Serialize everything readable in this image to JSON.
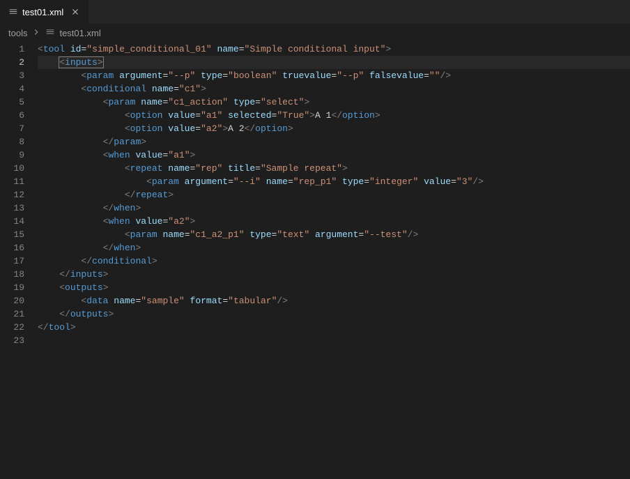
{
  "tab": {
    "filename": "test01.xml"
  },
  "breadcrumb": {
    "folder": "tools",
    "file": "test01.xml"
  },
  "editor": {
    "activeLine": 2,
    "lines": [
      {
        "n": 1,
        "indent": 0,
        "segments": [
          {
            "t": "brkt",
            "v": "<"
          },
          {
            "t": "tag",
            "v": "tool"
          },
          {
            "t": "txt",
            "v": " "
          },
          {
            "t": "attr",
            "v": "id"
          },
          {
            "t": "txt",
            "v": "="
          },
          {
            "t": "str",
            "v": "\"simple_conditional_01\""
          },
          {
            "t": "txt",
            "v": " "
          },
          {
            "t": "attr",
            "v": "name"
          },
          {
            "t": "txt",
            "v": "="
          },
          {
            "t": "str",
            "v": "\"Simple conditional input\""
          },
          {
            "t": "brkt",
            "v": ">"
          }
        ]
      },
      {
        "n": 2,
        "indent": 1,
        "segments": [
          {
            "t": "brkt",
            "v": "<"
          },
          {
            "t": "tag",
            "v": "inputs"
          },
          {
            "t": "brkt",
            "v": ">"
          }
        ],
        "outline": true
      },
      {
        "n": 3,
        "indent": 2,
        "segments": [
          {
            "t": "brkt",
            "v": "<"
          },
          {
            "t": "tag",
            "v": "param"
          },
          {
            "t": "txt",
            "v": " "
          },
          {
            "t": "attr",
            "v": "argument"
          },
          {
            "t": "txt",
            "v": "="
          },
          {
            "t": "str",
            "v": "\"--p\""
          },
          {
            "t": "txt",
            "v": " "
          },
          {
            "t": "attr",
            "v": "type"
          },
          {
            "t": "txt",
            "v": "="
          },
          {
            "t": "str",
            "v": "\"boolean\""
          },
          {
            "t": "txt",
            "v": " "
          },
          {
            "t": "attr",
            "v": "truevalue"
          },
          {
            "t": "txt",
            "v": "="
          },
          {
            "t": "str",
            "v": "\"--p\""
          },
          {
            "t": "txt",
            "v": " "
          },
          {
            "t": "attr",
            "v": "falsevalue"
          },
          {
            "t": "txt",
            "v": "="
          },
          {
            "t": "str",
            "v": "\"\""
          },
          {
            "t": "brkt",
            "v": "/>"
          }
        ]
      },
      {
        "n": 4,
        "indent": 2,
        "segments": [
          {
            "t": "brkt",
            "v": "<"
          },
          {
            "t": "tag",
            "v": "conditional"
          },
          {
            "t": "txt",
            "v": " "
          },
          {
            "t": "attr",
            "v": "name"
          },
          {
            "t": "txt",
            "v": "="
          },
          {
            "t": "str",
            "v": "\"c1\""
          },
          {
            "t": "brkt",
            "v": ">"
          }
        ]
      },
      {
        "n": 5,
        "indent": 3,
        "segments": [
          {
            "t": "brkt",
            "v": "<"
          },
          {
            "t": "tag",
            "v": "param"
          },
          {
            "t": "txt",
            "v": " "
          },
          {
            "t": "attr",
            "v": "name"
          },
          {
            "t": "txt",
            "v": "="
          },
          {
            "t": "str",
            "v": "\"c1_action\""
          },
          {
            "t": "txt",
            "v": " "
          },
          {
            "t": "attr",
            "v": "type"
          },
          {
            "t": "txt",
            "v": "="
          },
          {
            "t": "str",
            "v": "\"select\""
          },
          {
            "t": "brkt",
            "v": ">"
          }
        ]
      },
      {
        "n": 6,
        "indent": 4,
        "segments": [
          {
            "t": "brkt",
            "v": "<"
          },
          {
            "t": "tag",
            "v": "option"
          },
          {
            "t": "txt",
            "v": " "
          },
          {
            "t": "attr",
            "v": "value"
          },
          {
            "t": "txt",
            "v": "="
          },
          {
            "t": "str",
            "v": "\"a1\""
          },
          {
            "t": "txt",
            "v": " "
          },
          {
            "t": "attr",
            "v": "selected"
          },
          {
            "t": "txt",
            "v": "="
          },
          {
            "t": "str",
            "v": "\"True\""
          },
          {
            "t": "brkt",
            "v": ">"
          },
          {
            "t": "txt",
            "v": "A 1"
          },
          {
            "t": "brkt",
            "v": "</"
          },
          {
            "t": "tag",
            "v": "option"
          },
          {
            "t": "brkt",
            "v": ">"
          }
        ]
      },
      {
        "n": 7,
        "indent": 4,
        "segments": [
          {
            "t": "brkt",
            "v": "<"
          },
          {
            "t": "tag",
            "v": "option"
          },
          {
            "t": "txt",
            "v": " "
          },
          {
            "t": "attr",
            "v": "value"
          },
          {
            "t": "txt",
            "v": "="
          },
          {
            "t": "str",
            "v": "\"a2\""
          },
          {
            "t": "brkt",
            "v": ">"
          },
          {
            "t": "txt",
            "v": "A 2"
          },
          {
            "t": "brkt",
            "v": "</"
          },
          {
            "t": "tag",
            "v": "option"
          },
          {
            "t": "brkt",
            "v": ">"
          }
        ]
      },
      {
        "n": 8,
        "indent": 3,
        "segments": [
          {
            "t": "brkt",
            "v": "</"
          },
          {
            "t": "tag",
            "v": "param"
          },
          {
            "t": "brkt",
            "v": ">"
          }
        ]
      },
      {
        "n": 9,
        "indent": 3,
        "segments": [
          {
            "t": "brkt",
            "v": "<"
          },
          {
            "t": "tag",
            "v": "when"
          },
          {
            "t": "txt",
            "v": " "
          },
          {
            "t": "attr",
            "v": "value"
          },
          {
            "t": "txt",
            "v": "="
          },
          {
            "t": "str",
            "v": "\"a1\""
          },
          {
            "t": "brkt",
            "v": ">"
          }
        ]
      },
      {
        "n": 10,
        "indent": 4,
        "segments": [
          {
            "t": "brkt",
            "v": "<"
          },
          {
            "t": "tag",
            "v": "repeat"
          },
          {
            "t": "txt",
            "v": " "
          },
          {
            "t": "attr",
            "v": "name"
          },
          {
            "t": "txt",
            "v": "="
          },
          {
            "t": "str",
            "v": "\"rep\""
          },
          {
            "t": "txt",
            "v": " "
          },
          {
            "t": "attr",
            "v": "title"
          },
          {
            "t": "txt",
            "v": "="
          },
          {
            "t": "str",
            "v": "\"Sample repeat\""
          },
          {
            "t": "brkt",
            "v": ">"
          }
        ]
      },
      {
        "n": 11,
        "indent": 5,
        "segments": [
          {
            "t": "brkt",
            "v": "<"
          },
          {
            "t": "tag",
            "v": "param"
          },
          {
            "t": "txt",
            "v": " "
          },
          {
            "t": "attr",
            "v": "argument"
          },
          {
            "t": "txt",
            "v": "="
          },
          {
            "t": "str",
            "v": "\"--i\""
          },
          {
            "t": "txt",
            "v": " "
          },
          {
            "t": "attr",
            "v": "name"
          },
          {
            "t": "txt",
            "v": "="
          },
          {
            "t": "str",
            "v": "\"rep_p1\""
          },
          {
            "t": "txt",
            "v": " "
          },
          {
            "t": "attr",
            "v": "type"
          },
          {
            "t": "txt",
            "v": "="
          },
          {
            "t": "str",
            "v": "\"integer\""
          },
          {
            "t": "txt",
            "v": " "
          },
          {
            "t": "attr",
            "v": "value"
          },
          {
            "t": "txt",
            "v": "="
          },
          {
            "t": "str",
            "v": "\"3\""
          },
          {
            "t": "brkt",
            "v": "/>"
          }
        ]
      },
      {
        "n": 12,
        "indent": 4,
        "segments": [
          {
            "t": "brkt",
            "v": "</"
          },
          {
            "t": "tag",
            "v": "repeat"
          },
          {
            "t": "brkt",
            "v": ">"
          }
        ]
      },
      {
        "n": 13,
        "indent": 3,
        "segments": [
          {
            "t": "brkt",
            "v": "</"
          },
          {
            "t": "tag",
            "v": "when"
          },
          {
            "t": "brkt",
            "v": ">"
          }
        ]
      },
      {
        "n": 14,
        "indent": 3,
        "segments": [
          {
            "t": "brkt",
            "v": "<"
          },
          {
            "t": "tag",
            "v": "when"
          },
          {
            "t": "txt",
            "v": " "
          },
          {
            "t": "attr",
            "v": "value"
          },
          {
            "t": "txt",
            "v": "="
          },
          {
            "t": "str",
            "v": "\"a2\""
          },
          {
            "t": "brkt",
            "v": ">"
          }
        ]
      },
      {
        "n": 15,
        "indent": 4,
        "segments": [
          {
            "t": "brkt",
            "v": "<"
          },
          {
            "t": "tag",
            "v": "param"
          },
          {
            "t": "txt",
            "v": " "
          },
          {
            "t": "attr",
            "v": "name"
          },
          {
            "t": "txt",
            "v": "="
          },
          {
            "t": "str",
            "v": "\"c1_a2_p1\""
          },
          {
            "t": "txt",
            "v": " "
          },
          {
            "t": "attr",
            "v": "type"
          },
          {
            "t": "txt",
            "v": "="
          },
          {
            "t": "str",
            "v": "\"text\""
          },
          {
            "t": "txt",
            "v": " "
          },
          {
            "t": "attr",
            "v": "argument"
          },
          {
            "t": "txt",
            "v": "="
          },
          {
            "t": "str",
            "v": "\"--test\""
          },
          {
            "t": "brkt",
            "v": "/>"
          }
        ]
      },
      {
        "n": 16,
        "indent": 3,
        "segments": [
          {
            "t": "brkt",
            "v": "</"
          },
          {
            "t": "tag",
            "v": "when"
          },
          {
            "t": "brkt",
            "v": ">"
          }
        ]
      },
      {
        "n": 17,
        "indent": 2,
        "segments": [
          {
            "t": "brkt",
            "v": "</"
          },
          {
            "t": "tag",
            "v": "conditional"
          },
          {
            "t": "brkt",
            "v": ">"
          }
        ]
      },
      {
        "n": 18,
        "indent": 1,
        "segments": [
          {
            "t": "brkt",
            "v": "</"
          },
          {
            "t": "tag",
            "v": "inputs"
          },
          {
            "t": "brkt",
            "v": ">"
          }
        ]
      },
      {
        "n": 19,
        "indent": 1,
        "segments": [
          {
            "t": "brkt",
            "v": "<"
          },
          {
            "t": "tag",
            "v": "outputs"
          },
          {
            "t": "brkt",
            "v": ">"
          }
        ]
      },
      {
        "n": 20,
        "indent": 2,
        "segments": [
          {
            "t": "brkt",
            "v": "<"
          },
          {
            "t": "tag",
            "v": "data"
          },
          {
            "t": "txt",
            "v": " "
          },
          {
            "t": "attr",
            "v": "name"
          },
          {
            "t": "txt",
            "v": "="
          },
          {
            "t": "str",
            "v": "\"sample\""
          },
          {
            "t": "txt",
            "v": " "
          },
          {
            "t": "attr",
            "v": "format"
          },
          {
            "t": "txt",
            "v": "="
          },
          {
            "t": "str",
            "v": "\"tabular\""
          },
          {
            "t": "brkt",
            "v": "/>"
          }
        ]
      },
      {
        "n": 21,
        "indent": 1,
        "segments": [
          {
            "t": "brkt",
            "v": "</"
          },
          {
            "t": "tag",
            "v": "outputs"
          },
          {
            "t": "brkt",
            "v": ">"
          }
        ]
      },
      {
        "n": 22,
        "indent": 0,
        "segments": [
          {
            "t": "brkt",
            "v": "</"
          },
          {
            "t": "tag",
            "v": "tool"
          },
          {
            "t": "brkt",
            "v": ">"
          }
        ]
      },
      {
        "n": 23,
        "indent": 0,
        "segments": []
      }
    ]
  }
}
